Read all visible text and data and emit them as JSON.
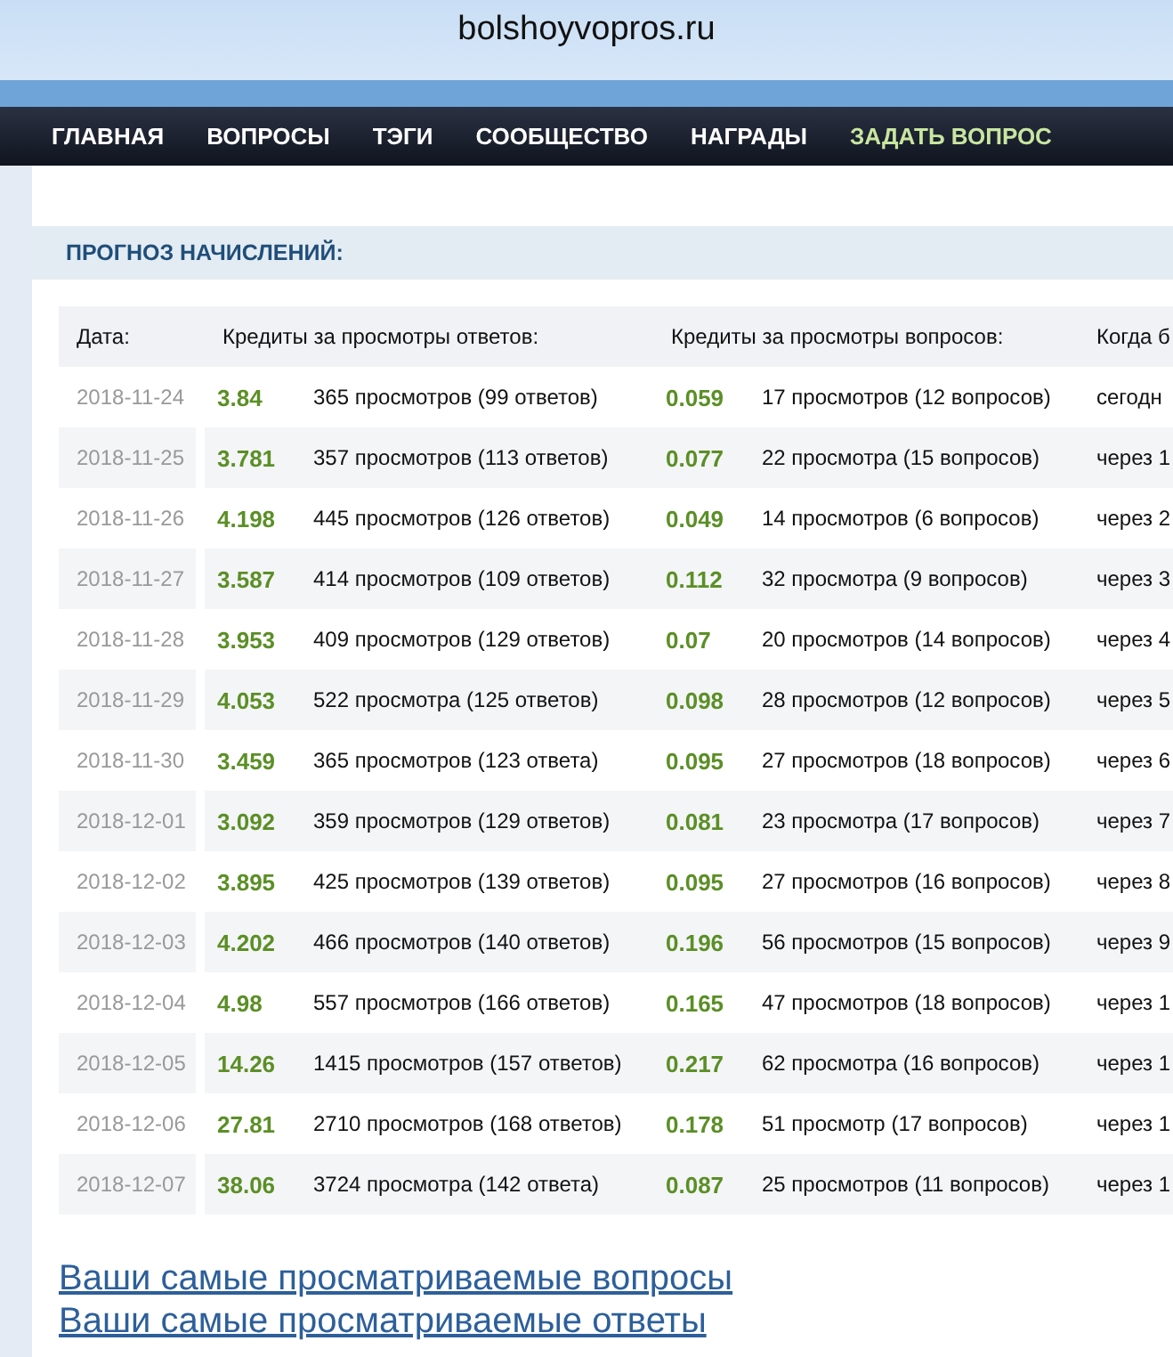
{
  "address_bar": {
    "url": "bolshoyvopros.ru"
  },
  "nav": [
    {
      "label": "ГЛАВНАЯ",
      "kind": "plain"
    },
    {
      "label": "ВОПРОСЫ",
      "kind": "plain"
    },
    {
      "label": "ТЭГИ",
      "kind": "plain"
    },
    {
      "label": "СООБЩЕСТВО",
      "kind": "plain"
    },
    {
      "label": "НАГРАДЫ",
      "kind": "plain"
    },
    {
      "label": "ЗАДАТЬ ВОПРОС",
      "kind": "action"
    }
  ],
  "panel": {
    "title": "ПРОГНОЗ НАЧИСЛЕНИЙ:",
    "table": {
      "columns": [
        "Дата:",
        "Кредиты за просмотры ответов:",
        "Кредиты за просмотры вопросов:",
        "Когда б"
      ],
      "rows": [
        {
          "date": "2018-11-24",
          "answers": {
            "credits": "3.84",
            "views": "365 просмотров (99 ответов)"
          },
          "questions": {
            "credits": "0.059",
            "views": "17 просмотров (12 вопросов)"
          },
          "when": "сегодн"
        },
        {
          "date": "2018-11-25",
          "answers": {
            "credits": "3.781",
            "views": "357 просмотров (113 ответов)"
          },
          "questions": {
            "credits": "0.077",
            "views": "22 просмотра (15 вопросов)"
          },
          "when": "через 1"
        },
        {
          "date": "2018-11-26",
          "answers": {
            "credits": "4.198",
            "views": "445 просмотров (126 ответов)"
          },
          "questions": {
            "credits": "0.049",
            "views": "14 просмотров (6 вопросов)"
          },
          "when": "через 2"
        },
        {
          "date": "2018-11-27",
          "answers": {
            "credits": "3.587",
            "views": "414 просмотров (109 ответов)"
          },
          "questions": {
            "credits": "0.112",
            "views": "32 просмотра (9 вопросов)"
          },
          "when": "через 3"
        },
        {
          "date": "2018-11-28",
          "answers": {
            "credits": "3.953",
            "views": "409 просмотров (129 ответов)"
          },
          "questions": {
            "credits": "0.07",
            "views": "20 просмотров (14 вопросов)"
          },
          "when": "через 4"
        },
        {
          "date": "2018-11-29",
          "answers": {
            "credits": "4.053",
            "views": "522 просмотра (125 ответов)"
          },
          "questions": {
            "credits": "0.098",
            "views": "28 просмотров (12 вопросов)"
          },
          "when": "через 5"
        },
        {
          "date": "2018-11-30",
          "answers": {
            "credits": "3.459",
            "views": "365 просмотров (123 ответа)"
          },
          "questions": {
            "credits": "0.095",
            "views": "27 просмотров (18 вопросов)"
          },
          "when": "через 6"
        },
        {
          "date": "2018-12-01",
          "answers": {
            "credits": "3.092",
            "views": "359 просмотров (129 ответов)"
          },
          "questions": {
            "credits": "0.081",
            "views": "23 просмотра (17 вопросов)"
          },
          "when": "через 7"
        },
        {
          "date": "2018-12-02",
          "answers": {
            "credits": "3.895",
            "views": "425 просмотров (139 ответов)"
          },
          "questions": {
            "credits": "0.095",
            "views": "27 просмотров (16 вопросов)"
          },
          "when": "через 8"
        },
        {
          "date": "2018-12-03",
          "answers": {
            "credits": "4.202",
            "views": "466 просмотров (140 ответов)"
          },
          "questions": {
            "credits": "0.196",
            "views": "56 просмотров (15 вопросов)"
          },
          "when": "через 9"
        },
        {
          "date": "2018-12-04",
          "answers": {
            "credits": "4.98",
            "views": "557 просмотров (166 ответов)"
          },
          "questions": {
            "credits": "0.165",
            "views": "47 просмотров (18 вопросов)"
          },
          "when": "через 1"
        },
        {
          "date": "2018-12-05",
          "answers": {
            "credits": "14.26",
            "views": "1415 просмотров (157 ответов)"
          },
          "questions": {
            "credits": "0.217",
            "views": "62 просмотра (16 вопросов)"
          },
          "when": "через 1"
        },
        {
          "date": "2018-12-06",
          "answers": {
            "credits": "27.81",
            "views": "2710 просмотров (168 ответов)"
          },
          "questions": {
            "credits": "0.178",
            "views": "51 просмотр (17 вопросов)"
          },
          "when": "через 1"
        },
        {
          "date": "2018-12-07",
          "answers": {
            "credits": "38.06",
            "views": "3724 просмотра (142 ответа)"
          },
          "questions": {
            "credits": "0.087",
            "views": "25 просмотров (11 вопросов)"
          },
          "when": "через 1"
        }
      ]
    }
  },
  "links": [
    "Ваши самые просматриваемые вопросы",
    "Ваши самые просматриваемые ответы"
  ]
}
